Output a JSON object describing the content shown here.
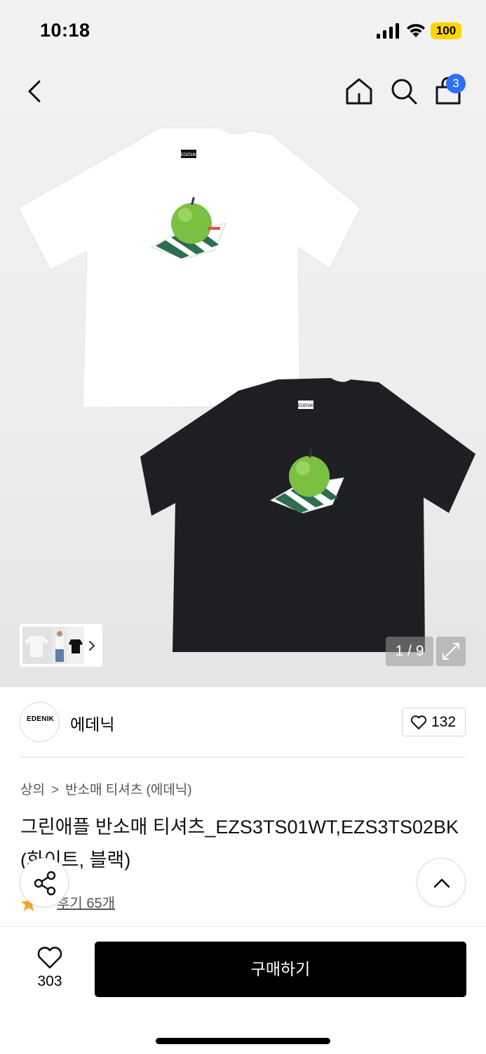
{
  "status_bar": {
    "time": "10:18",
    "battery": "100",
    "battery_color": "#ffd400"
  },
  "nav": {
    "back_icon": "chevron-left-icon",
    "home_icon": "home-icon",
    "search_icon": "search-icon",
    "cart_icon": "shopping-bag-icon",
    "cart_badge": "3",
    "badge_color": "#2f6df6"
  },
  "gallery": {
    "counter": "1 / 9",
    "expand_icon": "expand-icon",
    "thumbnail_more_icon": "chevron-right-icon",
    "tshirt_print_text": "EDENIK"
  },
  "brand": {
    "logo_text": "EDENIK",
    "name": "에데닉",
    "like_icon": "heart-outline-icon",
    "like_count": "132"
  },
  "breadcrumb": {
    "category": "상의",
    "separator": ">",
    "subcategory": "반소매 티셔츠 (에데닉)"
  },
  "product": {
    "title": "그린애플 반소매 티셔츠_EZS3TS01WT,EZS3TS02BK (화이트, 블랙)",
    "review_label": "후기 65개",
    "rating_icon": "star-icon"
  },
  "floating": {
    "share_icon": "share-icon",
    "scroll_top_icon": "chevron-up-icon"
  },
  "bottom_bar": {
    "wish_count": "303",
    "wish_icon": "heart-outline-icon",
    "buy_label": "구매하기"
  }
}
